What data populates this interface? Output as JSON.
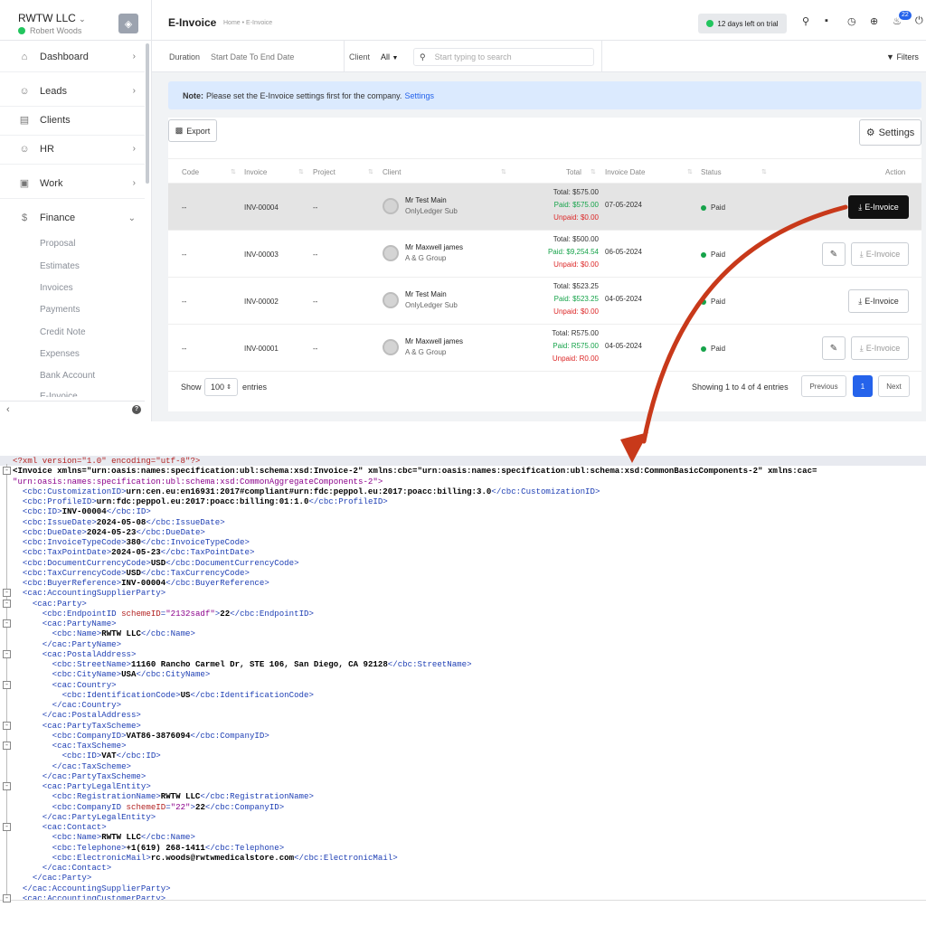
{
  "company": {
    "name": "RWTW LLC",
    "user": "Robert Woods"
  },
  "sidebar": {
    "items": [
      {
        "label": "Dashboard",
        "icon": "home-icon"
      },
      {
        "label": "Leads",
        "icon": "users-icon"
      },
      {
        "label": "Clients",
        "icon": "chart-icon"
      },
      {
        "label": "HR",
        "icon": "users-icon"
      },
      {
        "label": "Work",
        "icon": "briefcase-icon"
      },
      {
        "label": "Finance",
        "icon": "dollar-icon"
      }
    ],
    "finance_sub": [
      "Proposal",
      "Estimates",
      "Invoices",
      "Payments",
      "Credit Note",
      "Expenses",
      "Bank Account",
      "E-Invoice"
    ]
  },
  "header": {
    "title": "E-Invoice",
    "breadcrumb": "Home • E-Invoice",
    "trial": "12 days left on trial",
    "notif_count": "22"
  },
  "filters": {
    "duration_label": "Duration",
    "duration_value": "Start Date To End Date",
    "client_label": "Client",
    "client_value": "All",
    "search_placeholder": "Start typing to search",
    "filters_label": "Filters"
  },
  "note": {
    "label": "Note:",
    "text": "Please set the E-Invoice settings first for the company.",
    "link": "Settings"
  },
  "toolbar": {
    "export": "Export",
    "settings": "Settings"
  },
  "table": {
    "columns": [
      "Code",
      "Invoice",
      "Project",
      "Client",
      "Total",
      "Invoice Date",
      "Status",
      "Action"
    ],
    "rows": [
      {
        "code": "--",
        "invoice": "INV-00004",
        "project": "--",
        "client": "Mr Test Main",
        "company": "OnlyLedger Sub",
        "total": "Total: $575.00",
        "paid": "Paid: $575.00",
        "unpaid": "Unpaid: $0.00",
        "date": "07-05-2024",
        "status": "Paid",
        "action": "E-Invoice"
      },
      {
        "code": "--",
        "invoice": "INV-00003",
        "project": "--",
        "client": "Mr Maxwell james",
        "company": "A & G Group",
        "total": "Total: $500.00",
        "paid": "Paid: $9,254.54",
        "unpaid": "Unpaid: $0.00",
        "date": "06-05-2024",
        "status": "Paid",
        "action": "E-Invoice"
      },
      {
        "code": "--",
        "invoice": "INV-00002",
        "project": "--",
        "client": "Mr Test Main",
        "company": "OnlyLedger Sub",
        "total": "Total: $523.25",
        "paid": "Paid: $523.25",
        "unpaid": "Unpaid: $0.00",
        "date": "04-05-2024",
        "status": "Paid",
        "action": "E-Invoice"
      },
      {
        "code": "--",
        "invoice": "INV-00001",
        "project": "--",
        "client": "Mr Maxwell james",
        "company": "A & G Group",
        "total": "Total: R575.00",
        "paid": "Paid: R575.00",
        "unpaid": "Unpaid: R0.00",
        "date": "04-05-2024",
        "status": "Paid",
        "action": "E-Invoice"
      }
    ]
  },
  "pagination": {
    "show": "Show",
    "length": "100",
    "entries": "entries",
    "info": "Showing 1 to 4 of 4 entries",
    "prev": "Previous",
    "page": "1",
    "next": "Next"
  },
  "xml": {
    "decl": "<?xml version=\"1.0\" encoding=\"utf-8\"?>",
    "lines": [
      "<Invoice xmlns=\"urn:oasis:names:specification:ubl:schema:xsd:Invoice-2\" xmlns:cbc=\"urn:oasis:names:specification:ubl:schema:xsd:CommonBasicComponents-2\" xmlns:cac=",
      "\"urn:oasis:names:specification:ubl:schema:xsd:CommonAggregateComponents-2\">",
      "  <cbc:CustomizationID>urn:cen.eu:en16931:2017#compliant#urn:fdc:peppol.eu:2017:poacc:billing:3.0</cbc:CustomizationID>",
      "  <cbc:ProfileID>urn:fdc:peppol.eu:2017:poacc:billing:01:1.0</cbc:ProfileID>",
      "  <cbc:ID>INV-00004</cbc:ID>",
      "  <cbc:IssueDate>2024-05-08</cbc:IssueDate>",
      "  <cbc:DueDate>2024-05-23</cbc:DueDate>",
      "  <cbc:InvoiceTypeCode>380</cbc:InvoiceTypeCode>",
      "  <cbc:TaxPointDate>2024-05-23</cbc:TaxPointDate>",
      "  <cbc:DocumentCurrencyCode>USD</cbc:DocumentCurrencyCode>",
      "  <cbc:TaxCurrencyCode>USD</cbc:TaxCurrencyCode>",
      "  <cbc:BuyerReference>INV-00004</cbc:BuyerReference>",
      "  <cac:AccountingSupplierParty>",
      "    <cac:Party>",
      "      <cbc:EndpointID schemeID=\"2132sadf\">22</cbc:EndpointID>",
      "      <cac:PartyName>",
      "        <cbc:Name>RWTW LLC</cbc:Name>",
      "      </cac:PartyName>",
      "      <cac:PostalAddress>",
      "        <cbc:StreetName>11160 Rancho Carmel Dr, STE 106, San Diego, CA 92128</cbc:StreetName>",
      "        <cbc:CityName>USA</cbc:CityName>",
      "        <cac:Country>",
      "          <cbc:IdentificationCode>US</cbc:IdentificationCode>",
      "        </cac:Country>",
      "      </cac:PostalAddress>",
      "      <cac:PartyTaxScheme>",
      "        <cbc:CompanyID>VAT86-3876094</cbc:CompanyID>",
      "        <cac:TaxScheme>",
      "          <cbc:ID>VAT</cbc:ID>",
      "        </cac:TaxScheme>",
      "      </cac:PartyTaxScheme>",
      "      <cac:PartyLegalEntity>",
      "        <cbc:RegistrationName>RWTW LLC</cbc:RegistrationName>",
      "        <cbc:CompanyID schemeID=\"22\">22</cbc:CompanyID>",
      "      </cac:PartyLegalEntity>",
      "      <cac:Contact>",
      "        <cbc:Name>RWTW LLC</cbc:Name>",
      "        <cbc:Telephone>+1(619) 268-1411</cbc:Telephone>",
      "        <cbc:ElectronicMail>rc.woods@rwtwmedicalstore.com</cbc:ElectronicMail>",
      "      </cac:Contact>",
      "    </cac:Party>",
      "  </cac:AccountingSupplierParty>",
      "  <cac:AccountingCustomerParty>"
    ]
  },
  "colors": {
    "accent": "#2563eb",
    "arrow": "#c8391a",
    "paid": "#16a34a",
    "unpaid": "#dc2626",
    "note_bg": "#dbeafe"
  }
}
